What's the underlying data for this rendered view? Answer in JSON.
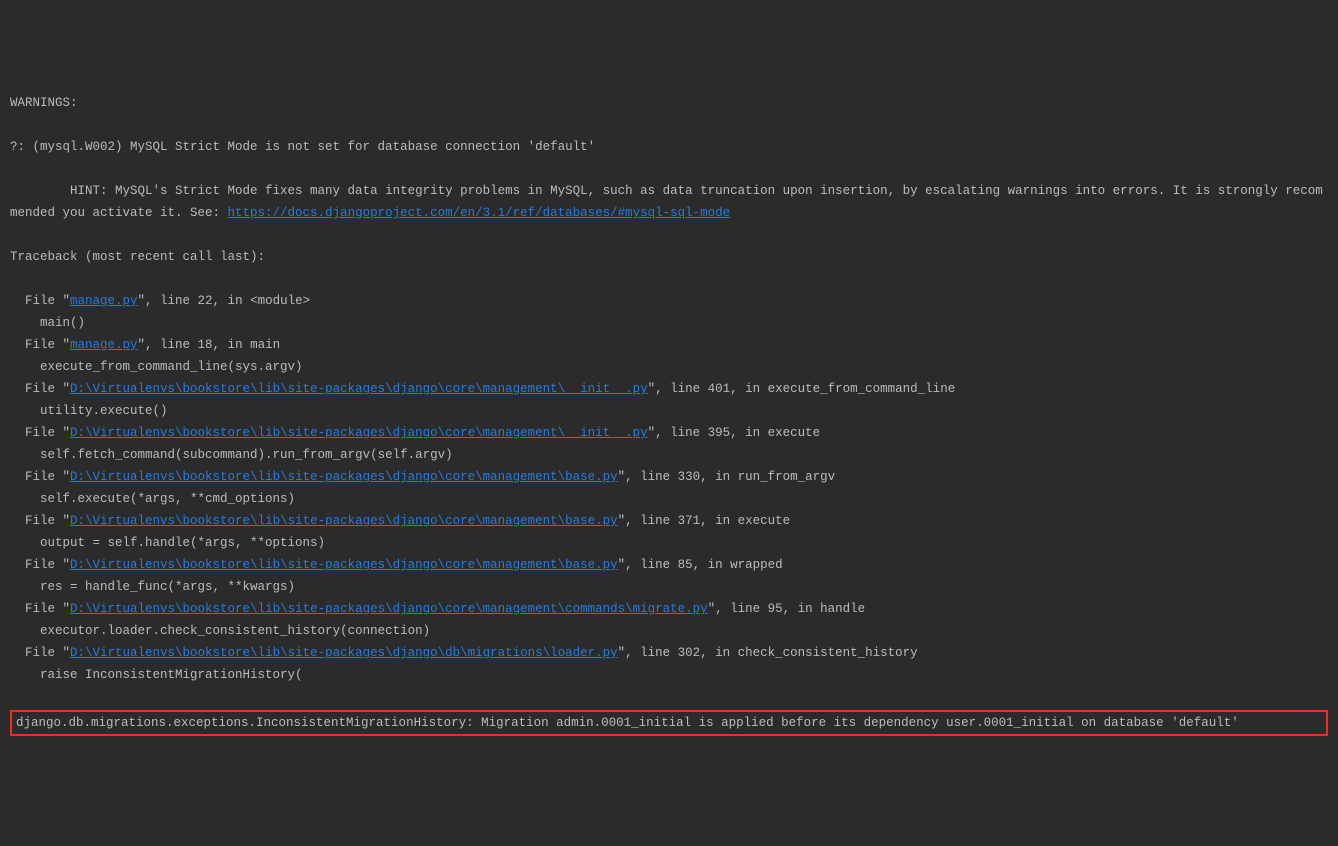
{
  "header": "WARNINGS:",
  "warning_q": "?: (mysql.W002) MySQL Strict Mode is not set for database connection 'default'",
  "hint_lead": "        HINT: MySQL's Strict Mode fixes many data integrity problems in MySQL, such as data truncation upon insertion, by escalating warnings into errors. It is strongly recommended you activate it. See: ",
  "hint_url": "https://docs.djangoproject.com/en/3.1/ref/databases/#mysql-sql-mode",
  "traceback_header": "Traceback (most recent call last):",
  "frames": [
    {
      "pre": "  File \"",
      "path": "manage.py",
      "post": "\", line 22, in <module>",
      "code": "    main()"
    },
    {
      "pre": "  File \"",
      "path": "manage.py",
      "post": "\", line 18, in main",
      "code": "    execute_from_command_line(sys.argv)"
    },
    {
      "pre": "  File \"",
      "path": "D:\\Virtualenvs\\bookstore\\lib\\site-packages\\django\\core\\management\\__init__.py",
      "post": "\", line 401, in execute_from_command_line",
      "code": "    utility.execute()"
    },
    {
      "pre": "  File \"",
      "path": "D:\\Virtualenvs\\bookstore\\lib\\site-packages\\django\\core\\management\\__init__.py",
      "post": "\", line 395, in execute",
      "code": "    self.fetch_command(subcommand).run_from_argv(self.argv)"
    },
    {
      "pre": "  File \"",
      "path": "D:\\Virtualenvs\\bookstore\\lib\\site-packages\\django\\core\\management\\base.py",
      "post": "\", line 330, in run_from_argv",
      "code": "    self.execute(*args, **cmd_options)"
    },
    {
      "pre": "  File \"",
      "path": "D:\\Virtualenvs\\bookstore\\lib\\site-packages\\django\\core\\management\\base.py",
      "post": "\", line 371, in execute",
      "code": "    output = self.handle(*args, **options)"
    },
    {
      "pre": "  File \"",
      "path": "D:\\Virtualenvs\\bookstore\\lib\\site-packages\\django\\core\\management\\base.py",
      "post": "\", line 85, in wrapped",
      "code": "    res = handle_func(*args, **kwargs)"
    },
    {
      "pre": "  File \"",
      "path": "D:\\Virtualenvs\\bookstore\\lib\\site-packages\\django\\core\\management\\commands\\migrate.py",
      "post": "\", line 95, in handle",
      "code": "    executor.loader.check_consistent_history(connection)"
    },
    {
      "pre": "  File \"",
      "path": "D:\\Virtualenvs\\bookstore\\lib\\site-packages\\django\\db\\migrations\\loader.py",
      "post": "\", line 302, in check_consistent_history",
      "code": "    raise InconsistentMigrationHistory("
    }
  ],
  "error_line": "django.db.migrations.exceptions.InconsistentMigrationHistory: Migration admin.0001_initial is applied before its dependency user.0001_initial on database 'default'"
}
